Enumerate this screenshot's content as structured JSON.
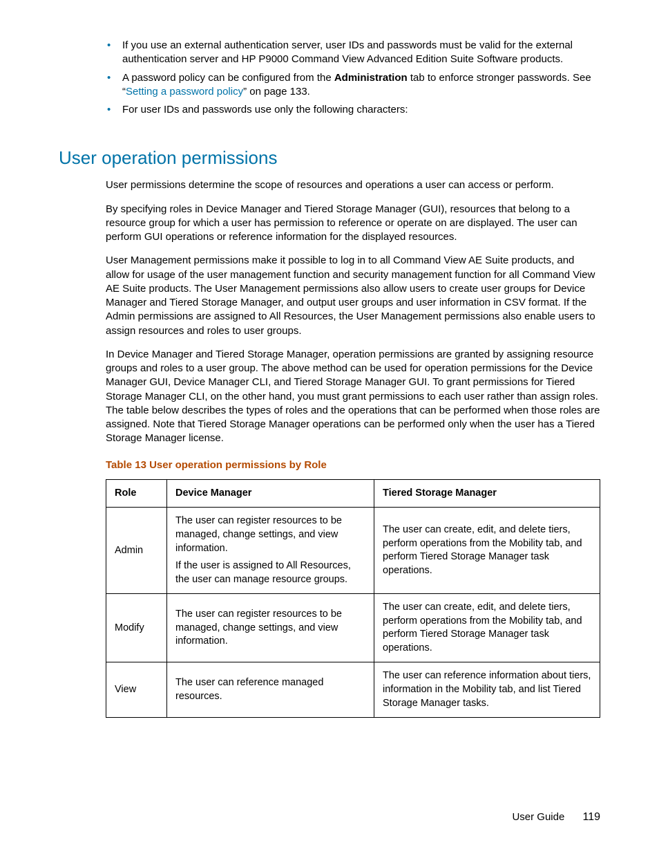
{
  "bullets": [
    {
      "text": "If you use an external authentication server, user IDs and passwords must be valid for the external authentication server and HP P9000 Command View Advanced Edition Suite Software products."
    },
    {
      "pre": "A password policy can be configured from the ",
      "bold": "Administration",
      "mid": " tab to enforce stronger passwords. See “",
      "link": "Setting a password policy",
      "post": "” on page 133."
    },
    {
      "text": "For user IDs and passwords use only the following characters:"
    }
  ],
  "section_heading": "User operation permissions",
  "paragraphs": [
    "User permissions determine the scope of resources and operations a user can access or perform.",
    "By specifying roles in Device Manager and Tiered Storage Manager (GUI), resources that belong to a resource group for which a user has permission to reference or operate on are displayed. The user can perform GUI operations or reference information for the displayed resources.",
    "User Management permissions make it possible to log in to all Command View AE Suite products, and allow for usage of the user management function and security management function for all Command View AE Suite products. The User Management permissions also allow users to create user groups for Device Manager and Tiered Storage Manager, and output user groups and user information in CSV format. If the Admin permissions are assigned to All Resources, the User Management permissions also enable users to assign resources and roles to user groups.",
    "In Device Manager and Tiered Storage Manager, operation permissions are granted by assigning resource groups and roles to a user group. The above method can be used for operation permissions for the Device Manager GUI, Device Manager CLI, and Tiered Storage Manager GUI. To grant permissions for Tiered Storage Manager CLI, on the other hand, you must grant permissions to each user rather than assign roles. The table below describes the types of roles and the operations that can be performed when those roles are assigned. Note that Tiered Storage Manager operations can be performed only when the user has a Tiered Storage Manager license."
  ],
  "table_caption": "Table 13 User operation permissions by Role",
  "table": {
    "headers": [
      "Role",
      "Device Manager",
      "Tiered Storage Manager"
    ],
    "rows": [
      {
        "role": "Admin",
        "dm_line1": "The user can register resources to be managed, change settings, and view information.",
        "dm_line2": "If the user is assigned to All Resources, the user can manage resource groups.",
        "tsm": "The user can create, edit, and delete tiers, perform operations from the Mobility tab, and perform Tiered Storage Manager task operations."
      },
      {
        "role": "Modify",
        "dm": "The user can register resources to be managed, change settings, and view information.",
        "tsm": "The user can create, edit, and delete tiers, perform operations from the Mobility tab, and perform Tiered Storage Manager task operations."
      },
      {
        "role": "View",
        "dm": "The user can reference managed resources.",
        "tsm": "The user can reference information about tiers, information in the Mobility tab, and list Tiered Storage Manager tasks."
      }
    ]
  },
  "footer_label": "User Guide",
  "footer_page": "119"
}
